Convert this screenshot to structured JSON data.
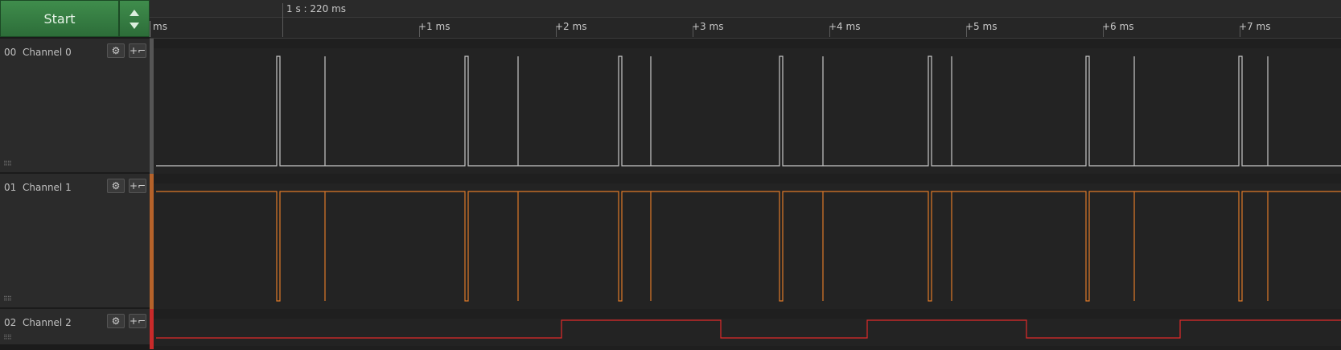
{
  "start": {
    "label": "Start"
  },
  "ruler": {
    "cursor_label": "1 s : 220 ms",
    "origin_label": "ms",
    "ticks": [
      "+1 ms",
      "+2 ms",
      "+3 ms",
      "+4 ms",
      "+5 ms",
      "+6 ms",
      "+7 ms"
    ]
  },
  "channels": [
    {
      "num": "00",
      "name": "Channel 0",
      "color": "#c8c8c8"
    },
    {
      "num": "01",
      "name": "Channel 1",
      "color": "#e07a28"
    },
    {
      "num": "02",
      "name": "Channel 2",
      "color": "#e02a2a"
    }
  ],
  "icons": {
    "settings": "gear-icon",
    "add_analyzer": "plus-edge-icon",
    "grip": "grip-icon"
  }
}
